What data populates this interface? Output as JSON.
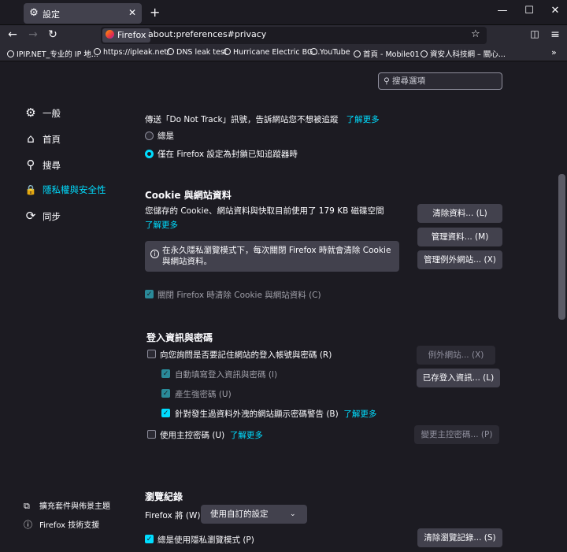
{
  "tab": {
    "icon": "gear-icon",
    "title": "設定",
    "new_tab": "+"
  },
  "window": {
    "minimize": "—",
    "maximize": "☐",
    "close": "✕"
  },
  "toolbar": {
    "back": "←",
    "forward": "→",
    "reload": "↻",
    "identity_label": "Firefox",
    "url": "about:preferences#privacy",
    "bookmark_star": "☆",
    "pocket": "◫",
    "menu": "≡"
  },
  "bookmarks": [
    "IPIP.NET_专业的 IP 地...",
    "https://ipleak.net/",
    "DNS leak test",
    "Hurricane Electric BG...",
    "YouTube",
    "首頁 - Mobile01",
    "資安人科技網 – 關心..."
  ],
  "bookmarks_overflow": "»",
  "search": {
    "placeholder": "搜尋選項"
  },
  "sidebar": {
    "items": [
      {
        "label": "一般",
        "icon": "gear-icon",
        "glyph": "⚙"
      },
      {
        "label": "首頁",
        "icon": "home-icon",
        "glyph": "⌂"
      },
      {
        "label": "搜尋",
        "icon": "search-icon",
        "glyph": "⚲"
      },
      {
        "label": "隱私權與安全性",
        "icon": "lock-icon",
        "glyph": "🔒"
      },
      {
        "label": "同步",
        "icon": "sync-icon",
        "glyph": "⟳"
      }
    ],
    "footer": [
      {
        "label": "擴充套件與佈景主題",
        "icon": "puzzle-icon",
        "glyph": "⧉"
      },
      {
        "label": "Firefox 技術支援",
        "icon": "help-icon",
        "glyph": "ⓘ"
      }
    ]
  },
  "dnt": {
    "text": "傳送「Do Not Track」訊號，告訴網站您不想被追蹤",
    "learn_more": "了解更多",
    "always": "總是",
    "only_blocking": "僅在 Firefox 設定為封鎖已知追蹤器時"
  },
  "cookies": {
    "heading": "Cookie 與網站資料",
    "description": "您儲存的 Cookie、網站資料與快取目前使用了 179 KB 磁碟空間",
    "learn_more": "了解更多",
    "clear_button": "清除資料... (L)",
    "manage_button": "管理資料... (M)",
    "exceptions_button": "管理例外網站... (X)",
    "info": "在永久隱私瀏覽模式下，每次關閉 Firefox 時就會清除 Cookie 與網站資料。",
    "delete_on_close": "關閉 Firefox 時清除 Cookie 與網站資料 (C)"
  },
  "logins": {
    "heading": "登入資訊與密碼",
    "ask_to_save": "向您詢問是否要記住網站的登入帳號與密碼 (R)",
    "exceptions_button": "例外網站... (X)",
    "autofill": "自動填寫登入資訊與密碼 (I)",
    "generate": "產生強密碼 (U)",
    "saved_logins_button": "已存登入資訊... (L)",
    "breach_alerts": "針對發生過資料外洩的網站顯示密碼警告 (B)",
    "breach_learn_more": "了解更多",
    "primary_password": "使用主控密碼 (U)",
    "primary_learn_more": "了解更多",
    "change_primary_button": "變更主控密碼... (P)"
  },
  "history": {
    "heading": "瀏覽紀錄",
    "firefox_will": "Firefox 將 (W)",
    "mode_select": "使用自訂的設定",
    "always_private": "總是使用隱私瀏覽模式 (P)",
    "clear_history_button": "清除瀏覽記錄... (S)"
  },
  "colors": {
    "accent": "#00ddff",
    "background": "#1c1b22",
    "button": "#42414d"
  }
}
